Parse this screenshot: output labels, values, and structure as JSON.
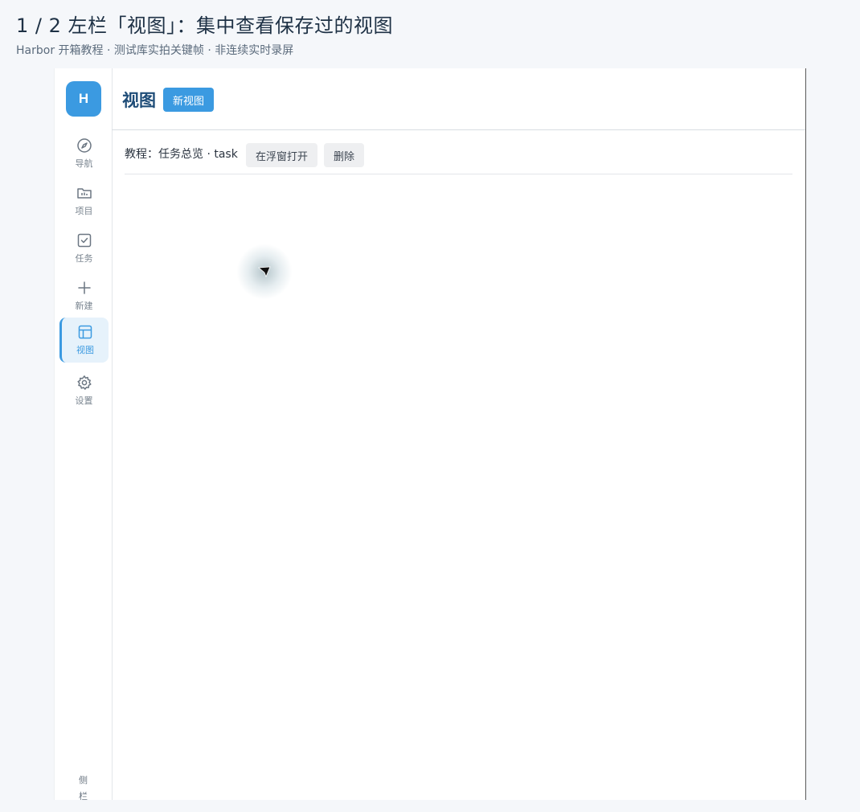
{
  "header": {
    "title": "1 / 2  左栏「视图」：集中查看保存过的视图",
    "subtitle": "Harbor 开箱教程 · 测试库实拍关键帧 · 非连续实时录屏"
  },
  "sidebar": {
    "logo": "H",
    "items": [
      {
        "label": "导航",
        "icon": "compass-icon"
      },
      {
        "label": "项目",
        "icon": "folder-icon"
      },
      {
        "label": "任务",
        "icon": "checkbox-icon"
      },
      {
        "label": "新建",
        "icon": "plus-icon"
      },
      {
        "label": "视图",
        "icon": "layout-icon",
        "active": true
      },
      {
        "label": "设置",
        "icon": "gear-icon"
      }
    ],
    "collapse_label": "侧\n栏",
    "accent_color": "#3b9ae1"
  },
  "main": {
    "title": "视图",
    "new_view_button": "新视图",
    "views": [
      {
        "name": "教程：任务总览 · task",
        "open_button": "在浮窗打开",
        "delete_button": "删除"
      }
    ]
  }
}
